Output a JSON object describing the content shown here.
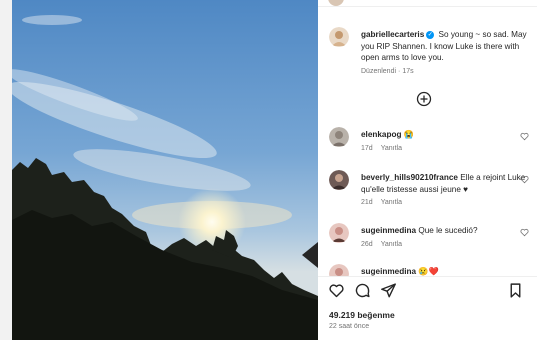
{
  "post": {
    "author": "gabriellecarteris",
    "caption": "So young ~ so sad. May you RIP Shannen. I know Luke is there with open arms to love you.",
    "edited_label": "Düzenlendi",
    "age": "17s",
    "load_more_icon": "plus-circle-icon"
  },
  "comments": [
    {
      "username": "elenkapog",
      "text": "😭",
      "age": "17d",
      "reply_label": "Yanıtla",
      "avatar_color": "#b9b2aa"
    },
    {
      "username": "beverly_hills90210france",
      "text": "Elle a rejoint Luke qu'elle tristesse aussi jeune ♥",
      "age": "21d",
      "reply_label": "Yanıtla",
      "avatar_color": "#6e5a55"
    },
    {
      "username": "sugeinmedina",
      "text": "Que le sucedió?",
      "age": "26d",
      "reply_label": "Yanıtla",
      "avatar_color": "#c98f86"
    },
    {
      "username": "sugeinmedina",
      "text": "😢❤️",
      "age": "",
      "reply_label": "",
      "avatar_color": "#c98f86"
    }
  ],
  "footer": {
    "likes": "49.219 beğenme",
    "date": "22 saat önce"
  },
  "colors": {
    "verified": "#0095f6",
    "muted": "#737373",
    "text": "#262626"
  }
}
